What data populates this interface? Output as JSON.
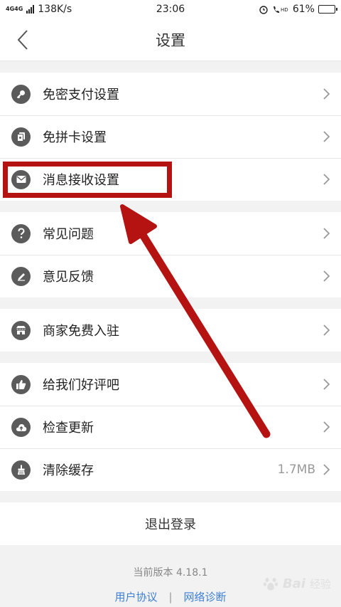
{
  "status_bar": {
    "network": "4G4G",
    "speed": "138K/s",
    "time": "23:06",
    "battery": "61%",
    "battery_level": 0.61
  },
  "header": {
    "title": "设置"
  },
  "groups": [
    [
      {
        "label": "免密支付设置",
        "icon": "key-icon"
      },
      {
        "label": "免拼卡设置",
        "icon": "card-icon"
      },
      {
        "label": "消息接收设置",
        "icon": "mail-icon"
      }
    ],
    [
      {
        "label": "常见问题",
        "icon": "question-icon"
      },
      {
        "label": "意见反馈",
        "icon": "pencil-icon"
      }
    ],
    [
      {
        "label": "商家免费入驻",
        "icon": "store-icon"
      }
    ],
    [
      {
        "label": "给我们好评吧",
        "icon": "thumbs-up-icon"
      },
      {
        "label": "检查更新",
        "icon": "cloud-upload-icon"
      },
      {
        "label": "清除缓存",
        "icon": "broom-icon",
        "value": "1.7MB"
      }
    ]
  ],
  "logout_label": "退出登录",
  "footer": {
    "version": "当前版本 4.18.1",
    "user_agreement": "用户协议",
    "separator": "|",
    "network_diagnosis": "网络诊断"
  },
  "watermark": {
    "brand": "Bai",
    "suffix": "经验"
  },
  "colors": {
    "annotation": "#b51212",
    "link": "#3d7fd6",
    "icon_bg": "#5b5b5b"
  }
}
